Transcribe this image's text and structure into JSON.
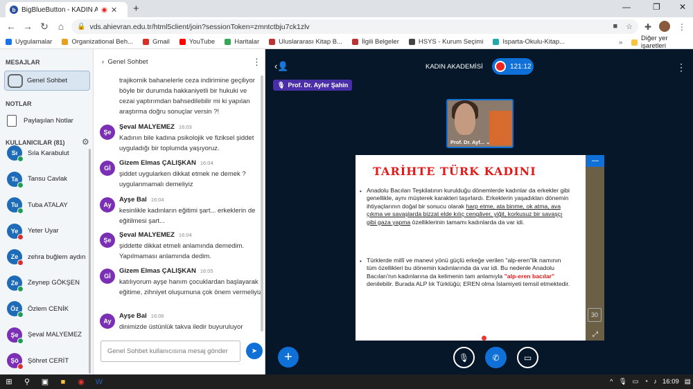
{
  "browser": {
    "tab_title": "BigBlueButton - KADIN AKAD",
    "url": "vds.ahievran.edu.tr/html5client/join?sessionToken=zmntctbju7ck1zlv",
    "bookmarks": [
      {
        "label": "Uygulamalar",
        "color": "#1a73e8"
      },
      {
        "label": "Organizational Beh...",
        "color": "#e8a020"
      },
      {
        "label": "Gmail",
        "color": "#d93025"
      },
      {
        "label": "YouTube",
        "color": "#ff0000"
      },
      {
        "label": "Haritalar",
        "color": "#34a853"
      },
      {
        "label": "Uluslararası Kitap B...",
        "color": "#b33"
      },
      {
        "label": "İlgili Belgeler",
        "color": "#b33"
      },
      {
        "label": "HSYS - Kurum Seçimi",
        "color": "#444"
      },
      {
        "label": "Isparta-Okulu-Kitap...",
        "color": "#2aa"
      }
    ],
    "other_bookmarks": "Diğer yer işaretleri"
  },
  "sidebar": {
    "messages_heading": "MESAJLAR",
    "public_chat": "Genel Sohbet",
    "notes_heading": "NOTLAR",
    "shared_notes": "Paylaşılan Notlar",
    "users_heading": "KULLANICILAR (81)",
    "users": [
      {
        "initials": "Sı",
        "name": "Sıla Karabulut",
        "color": "#1e6bb8",
        "status": "#1f9d55"
      },
      {
        "initials": "Ta",
        "name": "Tansu Cavlak",
        "color": "#1e6bb8",
        "status": "#1f9d55"
      },
      {
        "initials": "Tu",
        "name": "Tuba ATALAY",
        "color": "#1e6bb8",
        "status": "#1f9d55"
      },
      {
        "initials": "Ye",
        "name": "Yeter Uyar",
        "color": "#1e6bb8",
        "status": "#d9302c"
      },
      {
        "initials": "Ze",
        "name": "zehra buğlem aydın",
        "color": "#1e6bb8",
        "status": "#d9302c"
      },
      {
        "initials": "Ze",
        "name": "Zeynep GÖKŞEN",
        "color": "#1e6bb8",
        "status": "#1f9d55"
      },
      {
        "initials": "Öz",
        "name": "Özlem CENİK",
        "color": "#1e6bb8",
        "status": "#1f9d55"
      },
      {
        "initials": "Şe",
        "name": "Şeval MALYEMEZ",
        "color": "#7b2fb5",
        "status": "#1f9d55"
      },
      {
        "initials": "Şö",
        "name": "Şöhret CERİT",
        "color": "#7b2fb5",
        "status": "#d9302c"
      }
    ]
  },
  "chat": {
    "title": "Genel Sohbet",
    "first_text": "trajikomik bahanelerle ceza indirimine geçiliyor böyle bir durumda hakkaniyetli bir hukuki ve cezai yaptırımdan bahsedilebilir mi ki yapılan araştırma doğru sonuçlar versin ?!",
    "messages": [
      {
        "initials": "Şe",
        "color": "#7b2fb5",
        "name": "Şeval MALYEMEZ",
        "time": "16:03",
        "text": "Kadının bile kadına psikolojik ve fiziksel şiddet uyguladığı bir toplumda yaşıyoruz."
      },
      {
        "initials": "Gİ",
        "color": "#7b2fb5",
        "name": "Gizem Elmas ÇALIŞKAN",
        "time": "16:04",
        "text": "şiddet uygularken dikkat etmek ne demek ? uygulanmamalı demeliyiz"
      },
      {
        "initials": "Ay",
        "color": "#7b2fb5",
        "name": "Ayşe Bal",
        "time": "16:04",
        "text": "kesinlikle kadınların eğitimi şart... erkeklerin de eğitilmesi şart..."
      },
      {
        "initials": "Şe",
        "color": "#7b2fb5",
        "name": "Şeval MALYEMEZ",
        "time": "16:04",
        "text": "şiddette dikkat etmeli anlamında demedim. Yapılmaması anlamında dedim."
      },
      {
        "initials": "Gİ",
        "color": "#7b2fb5",
        "name": "Gizem Elmas ÇALIŞKAN",
        "time": "16:05",
        "text": "katılıyorum ayşe hanım çocuklardan başlayarak eğitime, zihniyet oluşumuna çok önem vermeliyiz"
      },
      {
        "initials": "Ay",
        "color": "#7b2fb5",
        "name": "Ayşe Bal",
        "time": "16:06",
        "text": "dinimizde üstünlük takva iledir buyuruluyor"
      }
    ],
    "input_placeholder": "Genel Sohbet kullanıcısına mesaj gönder"
  },
  "stage": {
    "meeting_title": "KADIN AKADEMİSİ",
    "recording_time": "121:12",
    "presenter_name": "Prof. Dr. Ayfer Şahin",
    "webcam_label": "Prof. Dr. Ayf...",
    "slide": {
      "title": "TARİHTE TÜRK KADINI",
      "para1_a": "Anadolu Bacıları Teşkilatının kurulduğu dönemlerde kadınlar da erkekler gibi genellikle, aynı müşterek karakteri taşırlardı. Erkeklerin yaşadıkları dönemin ihtiyaçlarının doğal bir sonucu olarak ",
      "para1_ul": "harp etme, ata binme, ok atma, ava çıkma ve savaşlarda bizzat elde kılıç cengâver, yiğit, korkusuz bir savaşçı gibi gaza yapma",
      "para1_b": " özelliklerinin tamamı kadınlarda da var idi.",
      "para2_a": "Türklerde millî ve manevi yönü güçlü erkeğe verilen \"alp-eren\"lik namının tüm özellikleri bu dönemin kadınlarında da var idi. Bu nedenle Anadolu Bacıları'nın kadınlarına da kelimenin tam anlamıyla ",
      "para2_red": "\"alp-eren bacılar\"",
      "para2_b": " denilebilir. Burada ALP lık Türklüğü; EREN olma İslamiyeti temsil etmektedir.",
      "page_number": "30"
    }
  },
  "taskbar": {
    "time": "16:09"
  }
}
